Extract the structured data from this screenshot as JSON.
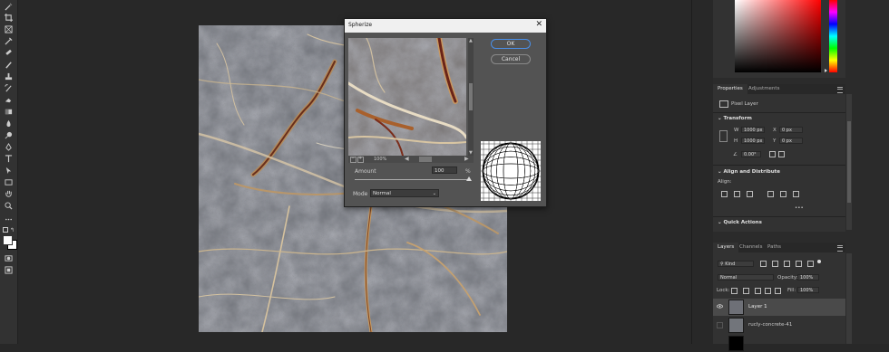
{
  "toolbar": {
    "tools": [
      "magic-wand-icon",
      "crop-icon",
      "frame-icon",
      "eyedropper-icon",
      "healing-icon",
      "brush-icon",
      "stamp-icon",
      "history-brush-icon",
      "eraser-icon",
      "gradient-icon",
      "blur-icon",
      "dodge-icon",
      "pen-icon",
      "type-icon",
      "path-select-icon",
      "rectangle-icon",
      "hand-icon",
      "zoom-icon",
      "more-icon",
      "swap-colors-icon",
      "foreground-color",
      "quick-mask-icon",
      "screen-mode-icon"
    ]
  },
  "dialog": {
    "title": "Spherize",
    "close": "✕",
    "ok_label": "OK",
    "cancel_label": "Cancel",
    "zoom_level": "100%",
    "zoom_minus": "−",
    "zoom_plus": "+",
    "amount_label": "Amount",
    "amount_value": "100",
    "amount_unit": "%",
    "amount_fraction": 1.0,
    "mode_label": "Mode",
    "mode_value": "Normal"
  },
  "properties": {
    "tabs": [
      "Properties",
      "Adjustments"
    ],
    "layer_type": "Pixel Layer",
    "transform_heading": "Transform",
    "w_label": "W",
    "w_value": "1000 px",
    "h_label": "H",
    "h_value": "1000 px",
    "x_label": "X",
    "x_value": "0 px",
    "y_label": "Y",
    "y_value": "0 px",
    "angle_value": "0.00°",
    "align_heading": "Align and Distribute",
    "align_label": "Align:",
    "more_label": "•••",
    "quick_actions_heading": "Quick Actions"
  },
  "layers": {
    "tabs": [
      "Layers",
      "Channels",
      "Paths"
    ],
    "filter_label": "Kind",
    "blend_mode": "Normal",
    "opacity_label": "Opacity:",
    "opacity_value": "100%",
    "lock_label": "Lock:",
    "fill_label": "Fill:",
    "fill_value": "100%",
    "rows": [
      {
        "name": "Layer 1",
        "selected": true
      },
      {
        "name": "rucly-concrete-41",
        "selected": false
      }
    ]
  },
  "colors": {
    "accent": "#4a8ee6",
    "panel_bg": "#323232",
    "app_bg": "#282828",
    "selected_layer": "#4a4a4a"
  }
}
